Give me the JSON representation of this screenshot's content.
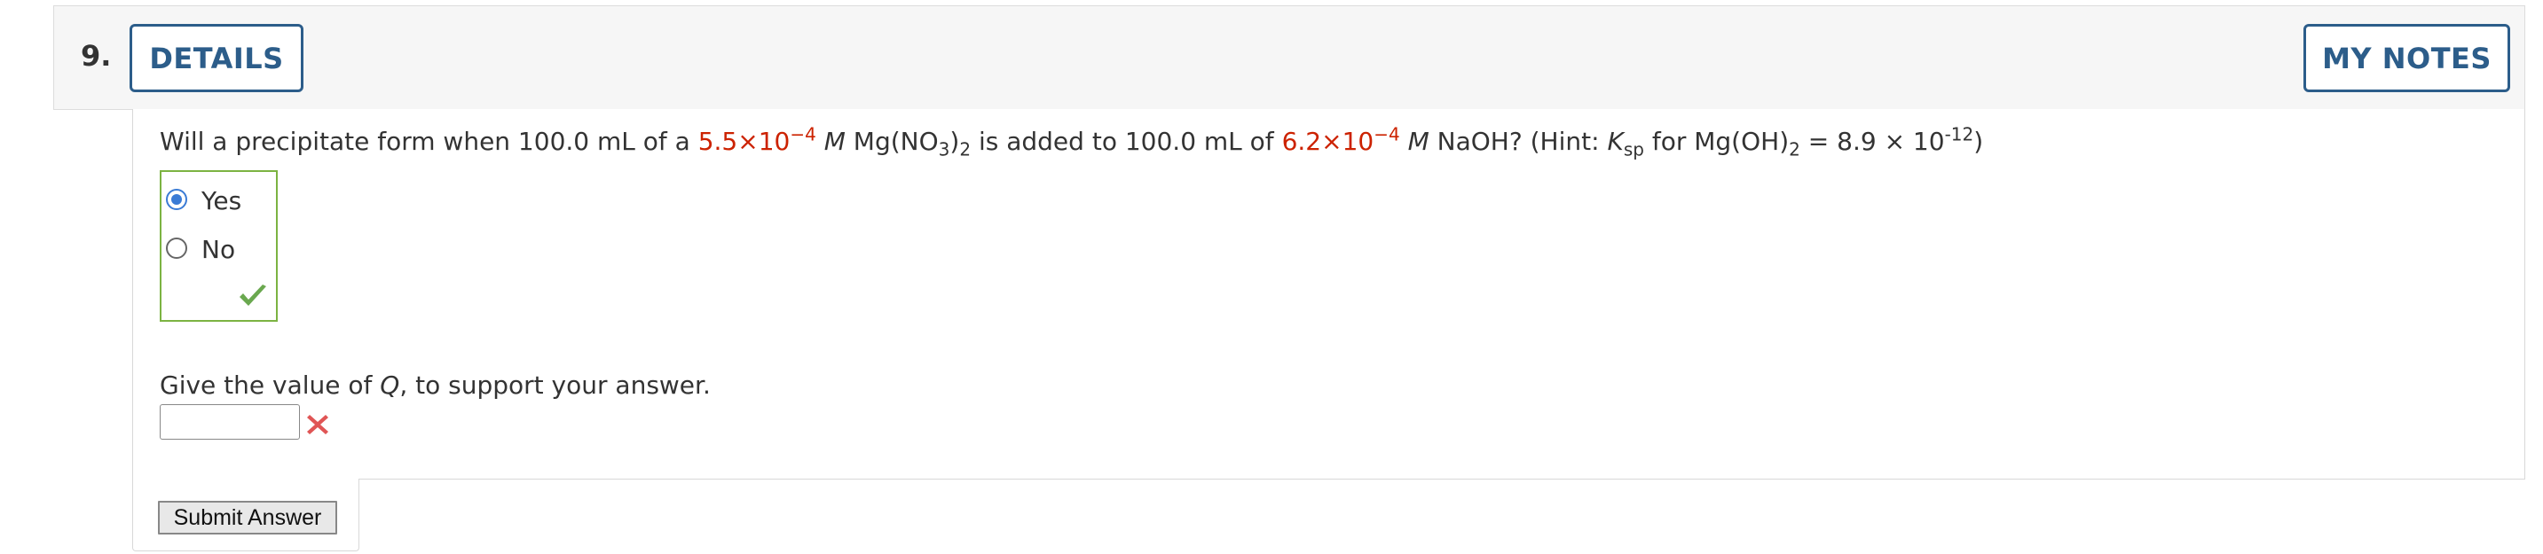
{
  "question": {
    "number": "9.",
    "details_label": "DETAILS",
    "my_notes_label": "MY NOTES",
    "text": {
      "p1": "Will a precipitate form when 100.0 mL of a ",
      "conc1": "5.5×10",
      "conc1_exp": "−4",
      "unit1": "M",
      "p2_a": " Mg(NO",
      "p2_sub1": "3",
      "p2_b": ")",
      "p2_sub2": "2",
      "p2_c": " is added to 100.0 mL of ",
      "conc2": "6.2×10",
      "conc2_exp": "−4",
      "unit2": "M",
      "p3_a": " NaOH? (Hint: ",
      "ksp_k": "K",
      "ksp_sub": "sp",
      "p3_b": " for Mg(OH)",
      "p3_sub": "2",
      "p3_c": " = 8.9 × 10",
      "ksp_exp": "-12",
      "p3_end": ")"
    },
    "choices": [
      {
        "label": "Yes",
        "selected": true
      },
      {
        "label": "No",
        "selected": false
      }
    ],
    "part2": {
      "a": "Give the value of ",
      "q": "Q",
      "b": ", to support your answer."
    },
    "answer_value": "",
    "submit_label": "Submit Answer"
  },
  "colors": {
    "accent": "#2c5d8a",
    "red_value": "#cc2200",
    "correct": "#7cb342",
    "incorrect": "#e05555"
  }
}
